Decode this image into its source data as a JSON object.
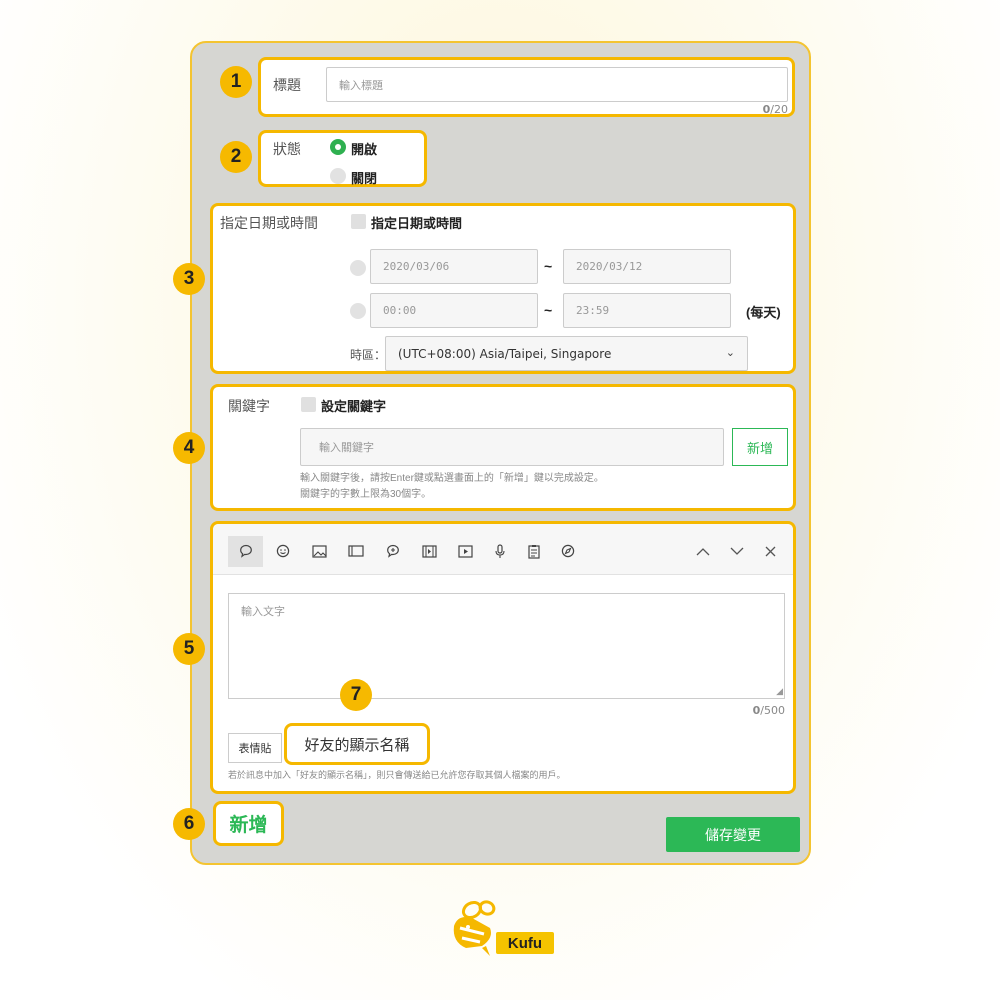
{
  "badges": [
    "1",
    "2",
    "3",
    "4",
    "5",
    "6",
    "7"
  ],
  "title_section": {
    "label": "標題",
    "placeholder": "輸入標題",
    "count_current": "0",
    "count_max": "/20"
  },
  "status_section": {
    "label": "狀態",
    "option_on": "開啟",
    "option_off": "關閉"
  },
  "date_section": {
    "label": "指定日期或時間",
    "checkbox_label": "指定日期或時間",
    "date_start": "2020/03/06",
    "date_end": "2020/03/12",
    "time_start": "00:00",
    "time_end": "23:59",
    "tilde": "~",
    "daily": "(每天)",
    "timezone_label": "時區：",
    "timezone_value": "(UTC+08:00) Asia/Taipei, Singapore"
  },
  "keyword_section": {
    "label": "關鍵字",
    "checkbox_label": "設定關鍵字",
    "placeholder": "輸入關鍵字",
    "add_label": "新增",
    "hint1": "輸入關鍵字後，請按Enter鍵或點選畫面上的「新增」鍵以完成設定。",
    "hint2": "關鍵字的字數上限為30個字。"
  },
  "message_section": {
    "text_placeholder": "輸入文字",
    "count_current": "0",
    "count_max": "/500",
    "emoji_button": "表情貼",
    "friend_name_button": "好友的顯示名稱",
    "hint": "若於訊息中加入「好友的顯示名稱」，則只會傳送給已允許您存取其個人檔案的用戶。"
  },
  "footer": {
    "add_label": "新增",
    "save_label": "儲存變更"
  },
  "logo": {
    "text": "Kufu"
  },
  "colors": {
    "accent_yellow": "#f5b800",
    "green": "#2cb856"
  }
}
